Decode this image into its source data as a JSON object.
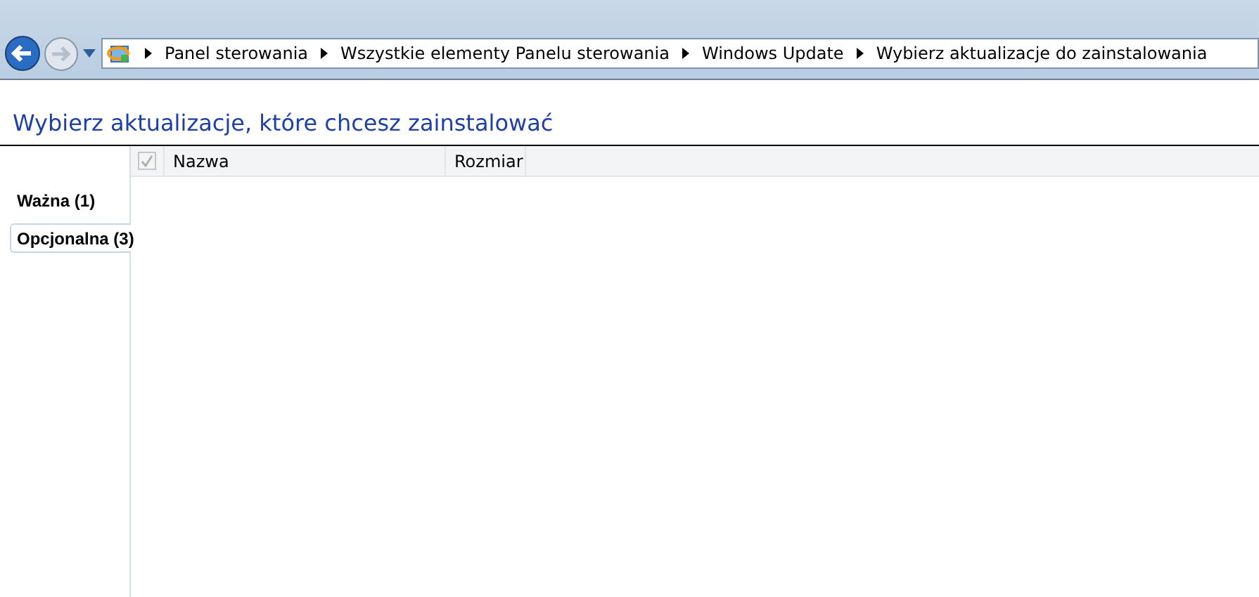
{
  "address_bar": {
    "breadcrumbs": [
      "Panel sterowania",
      "Wszystkie elementy Panelu sterowania",
      "Windows Update",
      "Wybierz aktualizacje do zainstalowania"
    ]
  },
  "heading": "Wybierz aktualizacje, które chcesz zainstalować",
  "categories": [
    {
      "label": "Ważna (1)",
      "selected": false
    },
    {
      "label": "Opcjonalna (3)",
      "selected": true
    }
  ],
  "table": {
    "select_all": {
      "checked": true,
      "disabled": true
    },
    "columns": [
      "Nazwa",
      "Rozmiar"
    ]
  }
}
